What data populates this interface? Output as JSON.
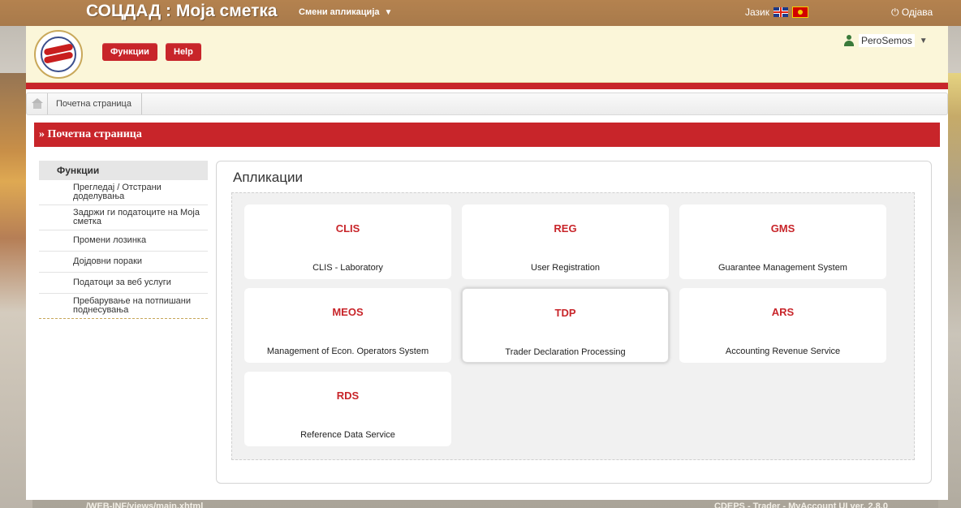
{
  "topbar": {
    "app_title": "СОЦДАД : Моја сметка",
    "switch_app": "Смени апликација",
    "language_label": "Јазик",
    "logout": "Одјава"
  },
  "header": {
    "functions_button": "Функции",
    "help_button": "Help",
    "user_name": "PeroSemos"
  },
  "breadcrumb": {
    "current": "Почетна страница"
  },
  "section_title": "» Почетна страница",
  "sidebar": {
    "title": "Функции",
    "items": [
      {
        "label": "Прегледај / Отстрани доделувања"
      },
      {
        "label": "Задржи ги податоците на Моја сметка"
      },
      {
        "label": "Промени лозинка"
      },
      {
        "label": "Дојдовни пораки"
      },
      {
        "label": "Податоци за веб услуги"
      },
      {
        "label": "Пребарување на потпишани поднесувања"
      }
    ]
  },
  "apps": {
    "title": "Апликации",
    "items": [
      {
        "code": "CLIS",
        "name": "CLIS - Laboratory"
      },
      {
        "code": "REG",
        "name": "User Registration"
      },
      {
        "code": "GMS",
        "name": "Guarantee Management System"
      },
      {
        "code": "MEOS",
        "name": "Management of Econ. Operators System"
      },
      {
        "code": "TDP",
        "name": "Trader Declaration Processing"
      },
      {
        "code": "ARS",
        "name": "Accounting Revenue Service"
      },
      {
        "code": "RDS",
        "name": "Reference Data Service"
      }
    ]
  },
  "footer": {
    "left": "/WEB-INF/views/main.xhtml",
    "right": "CDEPS - Trader - MyAccount UI ver. 2.8.0"
  }
}
